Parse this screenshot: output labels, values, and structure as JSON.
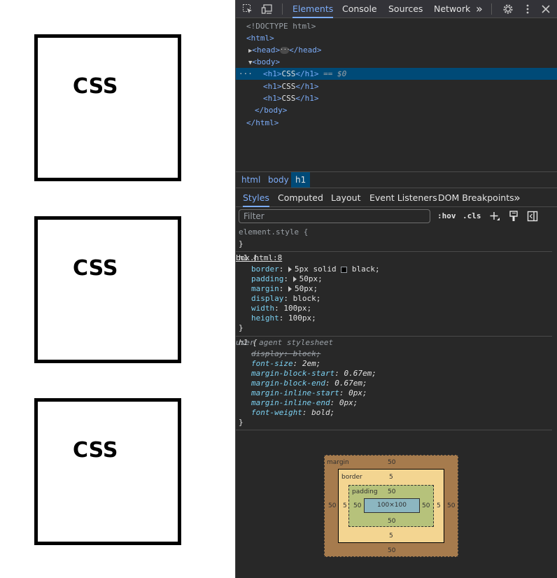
{
  "page": {
    "boxes": [
      {
        "text": "CSS"
      },
      {
        "text": "CSS"
      },
      {
        "text": "CSS"
      }
    ]
  },
  "devtools": {
    "tabs": [
      "Elements",
      "Console",
      "Sources",
      "Network"
    ],
    "active_tab": "Elements",
    "more_tabs_glyph": "»",
    "dom": {
      "doctype": "<!DOCTYPE html>",
      "html_open": "<html>",
      "head": "<head>",
      "head_close": "</head>",
      "body_open": "<body>",
      "h1_open": "<h1>",
      "h1_text": "CSS",
      "h1_close": "</h1>",
      "selected_suffix": "== $0",
      "body_close": "</body>",
      "html_close": "</html>",
      "ellipsis": "···"
    },
    "breadcrumbs": [
      "html",
      "body",
      "h1"
    ],
    "styles_tabs": [
      "Styles",
      "Computed",
      "Layout",
      "Event Listeners",
      "DOM Breakpoints"
    ],
    "active_styles_tab": "Styles",
    "filter_placeholder": "Filter",
    "hov": ":hov",
    "cls": ".cls",
    "rules": {
      "element_style": {
        "selector": "element.style {",
        "close": "}"
      },
      "author": {
        "selector": "h1 {",
        "source": "box.html:8",
        "declarations": [
          {
            "prop": "border",
            "value": "5px solid",
            "color_value": "black;"
          },
          {
            "prop": "padding",
            "value": "50px;"
          },
          {
            "prop": "margin",
            "value": "50px;"
          },
          {
            "prop": "display",
            "value": "block;"
          },
          {
            "prop": "width",
            "value": "100px;"
          },
          {
            "prop": "height",
            "value": "100px;"
          }
        ],
        "close": "}"
      },
      "user_agent": {
        "selector": "h1 {",
        "source": "user agent stylesheet",
        "overridden": "display: block;",
        "declarations": [
          {
            "prop": "font-size",
            "value": "2em;"
          },
          {
            "prop": "margin-block-start",
            "value": "0.67em;"
          },
          {
            "prop": "margin-block-end",
            "value": "0.67em;"
          },
          {
            "prop": "margin-inline-start",
            "value": "0px;"
          },
          {
            "prop": "margin-inline-end",
            "value": "0px;"
          },
          {
            "prop": "font-weight",
            "value": "bold;"
          }
        ],
        "close": "}"
      }
    },
    "box_model": {
      "margin_label": "margin",
      "border_label": "border",
      "padding_label": "padding",
      "content": "100×100",
      "margin": {
        "top": "50",
        "right": "50",
        "bottom": "50",
        "left": "50"
      },
      "border": {
        "top": "5",
        "right": "5",
        "bottom": "5",
        "left": "5"
      },
      "padding": {
        "top": "50",
        "right": "50",
        "bottom": "50",
        "left": "50"
      }
    },
    "colors": {
      "background": "#282828",
      "accent": "#7cacf8",
      "selected_row": "#004a77",
      "property": "#7cd1f2",
      "margin_box": "#a67b4d",
      "border_box": "#f3d591",
      "padding_box": "#b6c27b",
      "content_box": "#8cb6c0"
    }
  }
}
